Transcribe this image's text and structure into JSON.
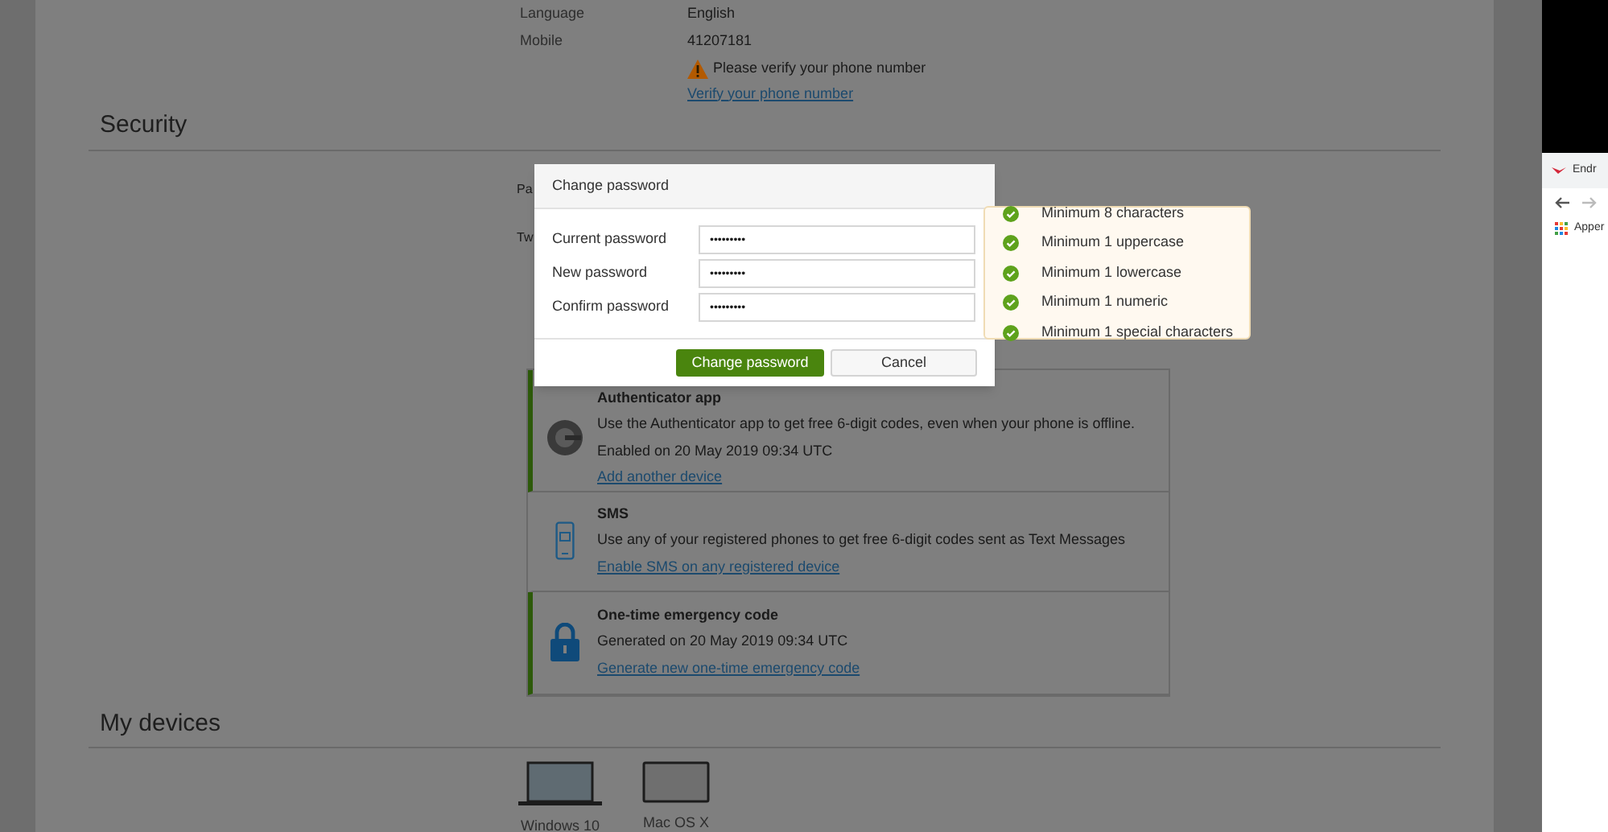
{
  "profile": {
    "rows": [
      {
        "label": "Language",
        "value": "English"
      },
      {
        "label": "Mobile",
        "value": "41207181"
      }
    ],
    "warning": "Please verify your phone number",
    "verify_link": "Verify your phone number"
  },
  "security": {
    "title": "Security",
    "hidden_labels": [
      "Pa",
      "Tw"
    ],
    "methods": [
      {
        "kind": "authenticator",
        "enabled": true,
        "title": "Authenticator app",
        "description": "Use the Authenticator app to get free 6-digit codes, even when your phone is offline.",
        "status": "Enabled on 20 May 2019 09:34 UTC",
        "link": "Add another device"
      },
      {
        "kind": "sms",
        "enabled": false,
        "title": "SMS",
        "description": "Use any of your registered phones to get free 6-digit codes sent as Text Messages",
        "link": "Enable SMS on any registered device"
      },
      {
        "kind": "emergency",
        "enabled": true,
        "title": "One-time emergency code",
        "status": "Generated on 20 May 2019 09:34 UTC",
        "link": "Generate new one-time emergency code"
      }
    ]
  },
  "devices": {
    "title": "My devices",
    "items": [
      {
        "kind": "windows",
        "name": "Windows 10"
      },
      {
        "kind": "mac",
        "name": "Mac OS X"
      }
    ]
  },
  "dialog": {
    "title": "Change password",
    "fields": [
      {
        "label": "Current password",
        "value": "•••••••••"
      },
      {
        "label": "New password",
        "value": "•••••••••"
      },
      {
        "label": "Confirm password",
        "value": "•••••••••"
      }
    ],
    "buttons": [
      {
        "kind": "primary",
        "label": "Change password"
      },
      {
        "kind": "secondary",
        "label": "Cancel"
      }
    ]
  },
  "requirements": [
    {
      "text": "Minimum 8 characters",
      "met": true
    },
    {
      "text": "Minimum 1 uppercase",
      "met": true
    },
    {
      "text": "Minimum 1 lowercase",
      "met": true
    },
    {
      "text": "Minimum 1 numeric",
      "met": true
    },
    {
      "text": "Minimum 1 special characters",
      "met": true
    }
  ],
  "browser": {
    "tab_title": "Endr",
    "bookmark": "Apper"
  }
}
